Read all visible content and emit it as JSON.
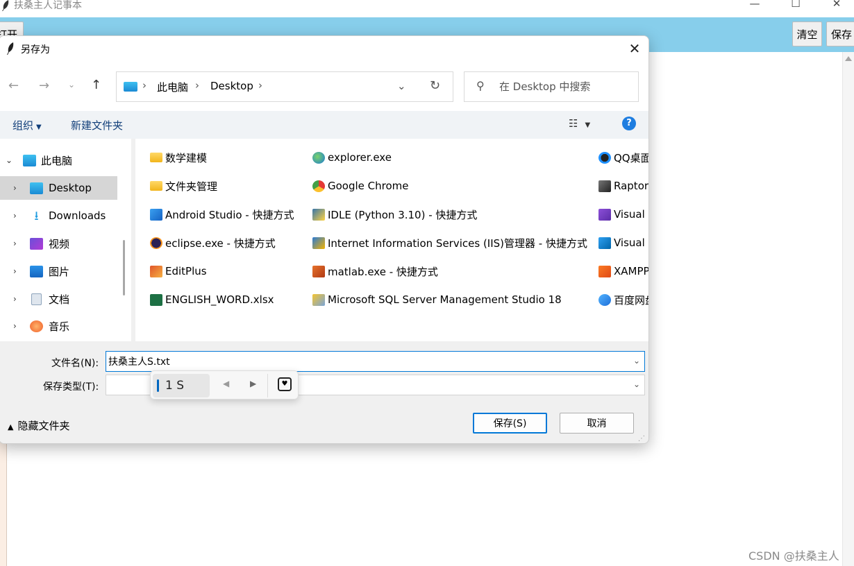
{
  "app": {
    "title": "扶桑主人记事本",
    "toolbar": {
      "open": "打开",
      "clear": "清空",
      "save": "保存"
    },
    "window_controls": {
      "minimize": "—",
      "maximize": "☐",
      "close": "✕"
    }
  },
  "dialog": {
    "title": "另存为",
    "close": "✕",
    "nav": {
      "back": "←",
      "forward": "→",
      "recent": "⌄",
      "up": "↑"
    },
    "breadcrumb": {
      "root": "此电脑",
      "current": "Desktop",
      "sep": "›"
    },
    "search_placeholder": "在 Desktop 中搜索",
    "commands": {
      "organize": "组织",
      "new_folder": "新建文件夹",
      "help": "?"
    },
    "tree": [
      {
        "label": "此电脑",
        "icon": "computer-icon"
      },
      {
        "label": "Desktop",
        "icon": "desktop-icon",
        "selected": true
      },
      {
        "label": "Downloads",
        "icon": "download-icon"
      },
      {
        "label": "视频",
        "icon": "video-icon"
      },
      {
        "label": "图片",
        "icon": "picture-icon"
      },
      {
        "label": "文档",
        "icon": "document-icon"
      },
      {
        "label": "音乐",
        "icon": "music-icon"
      }
    ],
    "files": [
      {
        "name": "数学建模",
        "icon": "folder-icon"
      },
      {
        "name": "文件夹管理",
        "icon": "folder-icon"
      },
      {
        "name": "Android Studio - 快捷方式",
        "icon": "android-studio-icon"
      },
      {
        "name": "eclipse.exe - 快捷方式",
        "icon": "eclipse-icon"
      },
      {
        "name": "EditPlus",
        "icon": "editplus-icon"
      },
      {
        "name": "ENGLISH_WORD.xlsx",
        "icon": "excel-icon"
      },
      {
        "name": "explorer.exe",
        "icon": "ie-icon"
      },
      {
        "name": "Google Chrome",
        "icon": "chrome-icon"
      },
      {
        "name": "IDLE (Python 3.10) - 快捷方式",
        "icon": "python-icon"
      },
      {
        "name": "Internet Information Services (IIS)管理器 - 快捷方式",
        "icon": "iis-icon"
      },
      {
        "name": "matlab.exe - 快捷方式",
        "icon": "matlab-icon"
      },
      {
        "name": "Microsoft SQL Server Management Studio 18",
        "icon": "sql-server-icon"
      },
      {
        "name": "QQ桌面",
        "icon": "qq-icon"
      },
      {
        "name": "Raptor",
        "icon": "raptor-icon"
      },
      {
        "name": "Visual",
        "icon": "visual-studio-icon"
      },
      {
        "name": "Visual",
        "icon": "vscode-icon"
      },
      {
        "name": "XAMPP",
        "icon": "xampp-icon"
      },
      {
        "name": "百度网盘",
        "icon": "baidu-netdisk-icon"
      }
    ],
    "form": {
      "filename_label": "文件名(N):",
      "filename_value": "扶桑主人S.txt",
      "filetype_label": "保存类型(T):",
      "filetype_value": "",
      "hide_folders": "隐藏文件夹",
      "save_button": "保存(S)",
      "cancel_button": "取消"
    }
  },
  "ime": {
    "candidate": "1 S"
  },
  "watermark": "CSDN @扶桑主人"
}
